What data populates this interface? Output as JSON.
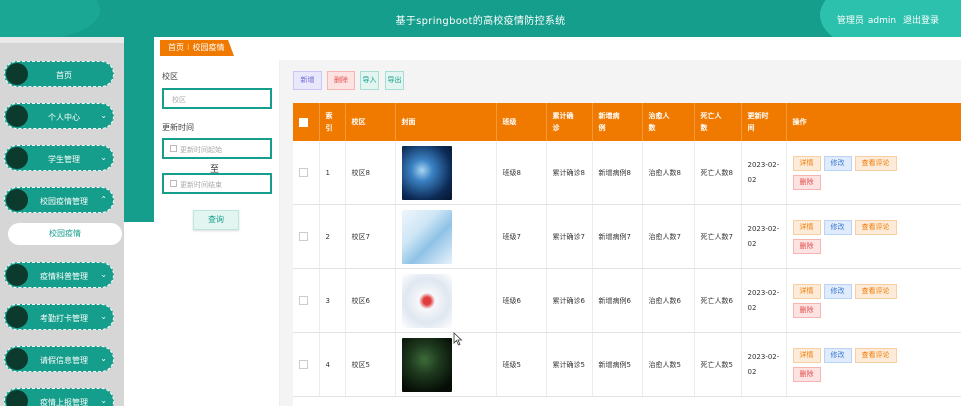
{
  "header": {
    "app_title": "基于springboot的高校疫情防控系统",
    "user_role": "管理员",
    "username": "admin",
    "logout_label": "退出登录"
  },
  "sidebar": {
    "items": [
      {
        "label": "首页",
        "chevron": ""
      },
      {
        "label": "个人中心",
        "chevron": "⌄"
      },
      {
        "label": "学生管理",
        "chevron": "⌄"
      },
      {
        "label": "校园疫情管理",
        "chevron": "⌃"
      },
      {
        "label": "疫情科普管理",
        "chevron": "⌄"
      },
      {
        "label": "考勤打卡管理",
        "chevron": "⌄"
      },
      {
        "label": "请假信息管理",
        "chevron": "⌄"
      },
      {
        "label": "疫情上报管理",
        "chevron": "⌄"
      }
    ],
    "active_sub": "校园疫情"
  },
  "breadcrumb": {
    "home": "首页",
    "separator": "⁝",
    "current": "校园疫情"
  },
  "filter": {
    "campus_label": "校区",
    "campus_placeholder": "校区",
    "time_label": "更新时间",
    "start_placeholder": "更新时间起始",
    "separator": "至",
    "end_placeholder": "更新时间结束",
    "query_label": "查询"
  },
  "actions": {
    "new": "新增",
    "delete": "删除",
    "import": "导入",
    "export": "导出"
  },
  "table": {
    "columns": [
      "索引",
      "校区",
      "封面",
      "班级",
      "累计确诊",
      "新增病例",
      "治愈人数",
      "死亡人数",
      "更新时间",
      "操作"
    ],
    "column_display": [
      "索\n引",
      "校区",
      "封面",
      "班级",
      "累计确\n诊",
      "新增病\n例",
      "治愈人\n数",
      "死亡人\n数",
      "更新时\n间",
      "操作"
    ],
    "rows": [
      {
        "index": "1",
        "campus": "校区8",
        "cover": "cover-image",
        "class": "班级8",
        "confirmed": "累计确诊8",
        "new_cases": "新增病例8",
        "cured": "治愈人数8",
        "deaths": "死亡人数8",
        "updated": "2023-02-02"
      },
      {
        "index": "2",
        "campus": "校区7",
        "cover": "cover-image",
        "class": "班级7",
        "confirmed": "累计确诊7",
        "new_cases": "新增病例7",
        "cured": "治愈人数7",
        "deaths": "死亡人数7",
        "updated": "2023-02-02"
      },
      {
        "index": "3",
        "campus": "校区6",
        "cover": "cover-image",
        "class": "班级6",
        "confirmed": "累计确诊6",
        "new_cases": "新增病例6",
        "cured": "治愈人数6",
        "deaths": "死亡人数6",
        "updated": "2023-02-02"
      },
      {
        "index": "4",
        "campus": "校区5",
        "cover": "cover-image",
        "class": "班级5",
        "confirmed": "累计确诊5",
        "new_cases": "新增病例5",
        "cured": "治愈人数5",
        "deaths": "死亡人数5",
        "updated": "2023-02-02"
      }
    ],
    "row_buttons": {
      "detail": "详情",
      "edit": "修改",
      "comments": "查看评论",
      "delete": "删除"
    }
  },
  "colors": {
    "primary": "#169e8c",
    "accent": "#f07a00",
    "sidebar_bg": "#d6d6d6",
    "nav_dot": "#0c3b2e"
  }
}
